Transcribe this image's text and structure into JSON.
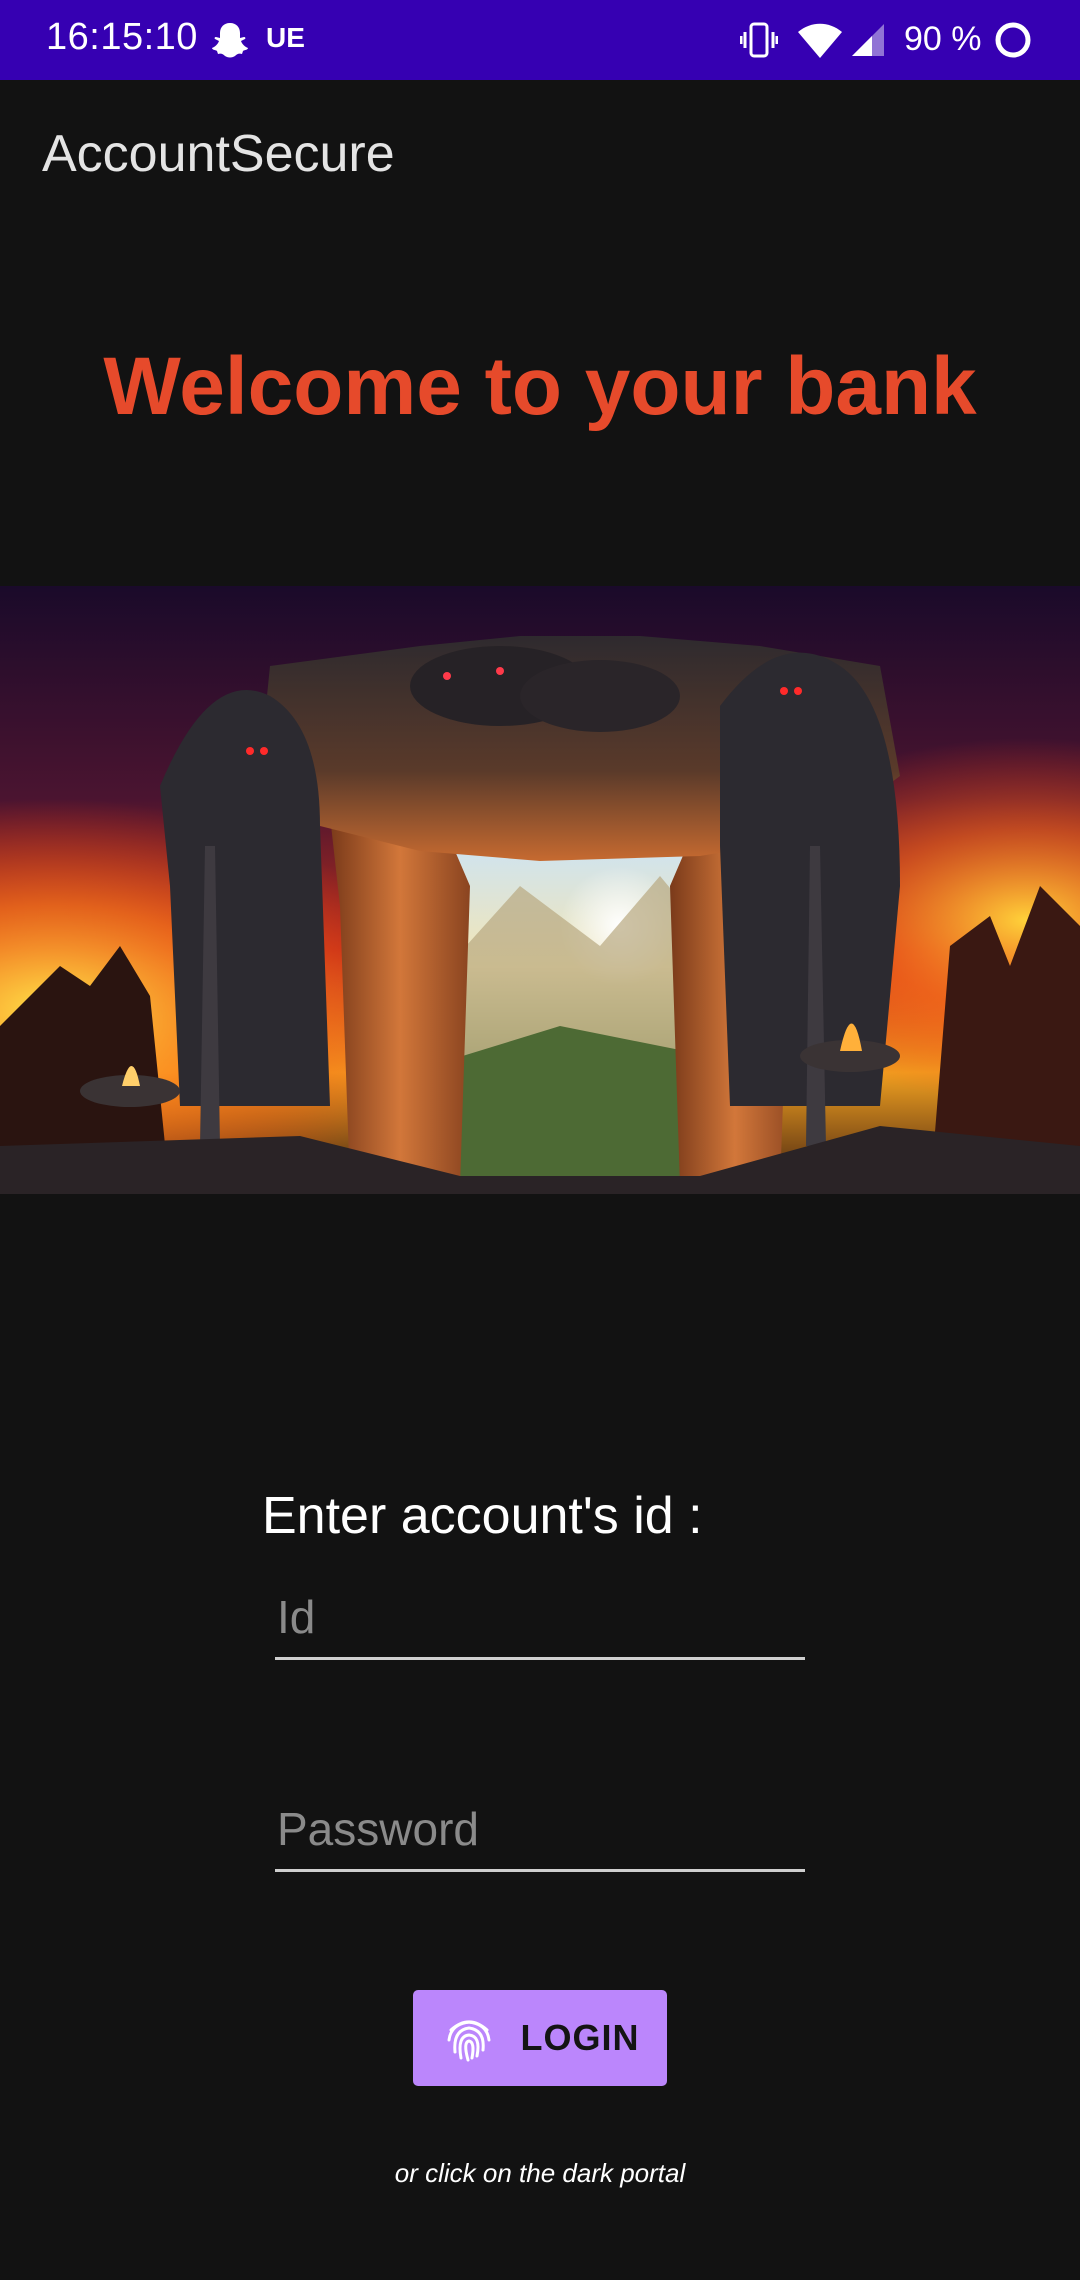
{
  "status_bar": {
    "time": "16:15:10",
    "carrier": "UE",
    "battery": "90 %",
    "icons": [
      "snapchat-icon",
      "vibrate-icon",
      "wifi-icon",
      "signal-icon",
      "battery-ring-icon"
    ],
    "background": "#3600b2"
  },
  "app_bar": {
    "title": "AccountSecure"
  },
  "welcome": {
    "text": "Welcome to your bank",
    "color": "#e64a2b"
  },
  "portal_image": {
    "description": "dark-portal-illustration"
  },
  "form": {
    "id_label": "Enter account's id :",
    "id_placeholder": "Id",
    "id_value": "",
    "password_placeholder": "Password",
    "password_value": "",
    "login_label": "LOGIN",
    "login_icon": "fingerprint-icon",
    "button_color": "#bb86fc",
    "hint": "or click on the dark portal"
  }
}
